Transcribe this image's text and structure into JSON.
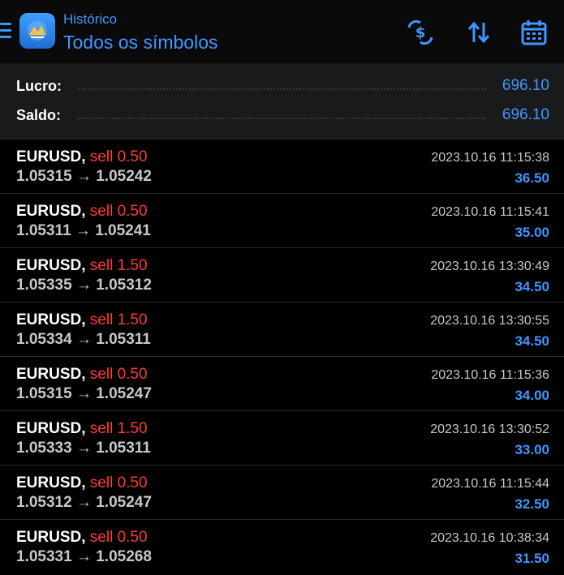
{
  "header": {
    "subtitle": "Histórico",
    "title": "Todos os símbolos",
    "icons": [
      "menu-icon",
      "app-logo",
      "currency-swap-icon",
      "sort-icon",
      "calendar-icon"
    ]
  },
  "summary": {
    "rows": [
      {
        "label": "Lucro:",
        "value": "696.10"
      },
      {
        "label": "Saldo:",
        "value": "696.10"
      }
    ]
  },
  "trades": [
    {
      "symbol": "EURUSD,",
      "side": "sell 0.50",
      "prices": "1.05315 → 1.05242",
      "time": "2023.10.16 11:15:38",
      "profit": "36.50"
    },
    {
      "symbol": "EURUSD,",
      "side": "sell 0.50",
      "prices": "1.05311 → 1.05241",
      "time": "2023.10.16 11:15:41",
      "profit": "35.00"
    },
    {
      "symbol": "EURUSD,",
      "side": "sell 1.50",
      "prices": "1.05335 → 1.05312",
      "time": "2023.10.16 13:30:49",
      "profit": "34.50"
    },
    {
      "symbol": "EURUSD,",
      "side": "sell 1.50",
      "prices": "1.05334 → 1.05311",
      "time": "2023.10.16 13:30:55",
      "profit": "34.50"
    },
    {
      "symbol": "EURUSD,",
      "side": "sell 0.50",
      "prices": "1.05315 → 1.05247",
      "time": "2023.10.16 11:15:36",
      "profit": "34.00"
    },
    {
      "symbol": "EURUSD,",
      "side": "sell 1.50",
      "prices": "1.05333 → 1.05311",
      "time": "2023.10.16 13:30:52",
      "profit": "33.00"
    },
    {
      "symbol": "EURUSD,",
      "side": "sell 0.50",
      "prices": "1.05312 → 1.05247",
      "time": "2023.10.16 11:15:44",
      "profit": "32.50"
    },
    {
      "symbol": "EURUSD,",
      "side": "sell 0.50",
      "prices": "1.05331 → 1.05268",
      "time": "2023.10.16 10:38:34",
      "profit": "31.50"
    }
  ],
  "colors": {
    "accent": "#3f97ff",
    "sell": "#ff3b30",
    "background": "#000000"
  }
}
